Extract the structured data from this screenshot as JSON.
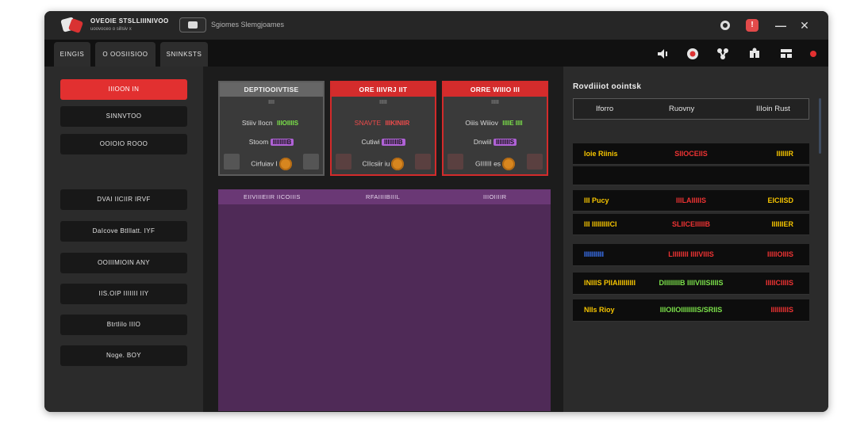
{
  "window": {
    "app_title": "OVEOIE STSLLIIINIVOO",
    "app_subtitle": "uoovoceo o sillsiv x",
    "search_text": "Sgiomes Slemgjoames",
    "controls": {
      "help": "help-icon",
      "alert": "!",
      "minimize": "—",
      "close": "✕"
    }
  },
  "tabs": [
    "EINGIS",
    "O OOSIISIOO",
    "SNINKSTS"
  ],
  "toolbar_icons": [
    "volume-icon",
    "record-icon",
    "share-icon",
    "puzzle-icon",
    "menu-icon",
    "status-dot-icon"
  ],
  "colors": {
    "accent": "#e23030",
    "purple": "#4f2a57",
    "green": "#7be04a",
    "yellow": "#f5c400",
    "blue": "#3e78ff"
  },
  "sidebar": {
    "items": [
      {
        "label": "IIIOON IN",
        "active": true
      },
      {
        "label": "SINNVTOO",
        "active": false
      },
      {
        "label": "OOIOIO ROOO",
        "active": false
      },
      {
        "label": "DVAI IICIIR IRVF",
        "active": false
      },
      {
        "label": "DaIcove Btlllatt. IYF",
        "active": false
      },
      {
        "label": "OOIIIMIOIN ANY",
        "active": false
      },
      {
        "label": "IIS.OIP IIIIIII IIY",
        "active": false
      },
      {
        "label": "Btrtlilo IIIO",
        "active": false
      },
      {
        "label": "Noge. BOY",
        "active": false
      }
    ]
  },
  "cards": [
    {
      "title": "DEPTIOOIVTISE",
      "sub": "IIII",
      "row1_label": "Stiiiv IIocn",
      "row1_value": "IIIOIIIIS",
      "row2_label": "Stoom",
      "row2_value": "IIIIIIIIB",
      "row3_label": "Cirfuiav I"
    },
    {
      "title": "ORE IIIVRJ IIT",
      "sub": "IIIII",
      "row1_label": "SNAVTE",
      "row1_value": "IIIKINIIR",
      "row2_label": "Cutiwi",
      "row2_value": "IIIIIIIIB",
      "row3_label": "CIIcsiir iu"
    },
    {
      "title": "ORRE WIIIO III",
      "sub": "IIIII",
      "row1_label": "Oiiis Wiiiov",
      "row1_value": "IIIIE IIII",
      "row2_label": "Dnwiil",
      "row2_value": "IIIIIIIIS",
      "row3_label": "GIIIIII es"
    }
  ],
  "purple_panel": {
    "headers": [
      "EIIVIIIEIIR IICOIIIS",
      "RFAIIIIBIIIL",
      "IIIOIIIIR"
    ]
  },
  "right_panel": {
    "title": "Rovdiiiot oointsk",
    "headers": [
      "Iforro",
      "Ruovny",
      "IIIoin Rust"
    ],
    "rows": [
      {
        "c1": "Ioie Riinis",
        "c2": "SIIOCEIIS",
        "c3": "IIIIIIR",
        "c1_color": "#f5c400",
        "c2_color": "#ee3333",
        "c3_color": "#f5c400"
      },
      {
        "c1": "",
        "c2": "",
        "c3": "",
        "c1_color": "#f5c400",
        "c2_color": "#ee3333",
        "c3_color": "#f5c400"
      },
      {
        "c1": "III Pucy",
        "c2": "IIILAIIIIIS",
        "c3": "EICIISD",
        "c1_color": "#f5c400",
        "c2_color": "#ee3333",
        "c3_color": "#f5c400"
      },
      {
        "c1": "III IIIIIIIIICI",
        "c2": "SLIICEIIIIIB",
        "c3": "IIIIIIER",
        "c1_color": "#f5c400",
        "c2_color": "#ee3333",
        "c3_color": "#f5c400"
      },
      {
        "c1": "IIIIIIIIII",
        "c2": "LIIIIIIII IIIIVIIIS",
        "c3": "IIIIIOIIIS",
        "c1_color": "#3e78ff",
        "c2_color": "#ee3333",
        "c3_color": "#ee3333"
      },
      {
        "c1": "INIIIS PIIAIIIIIIIII",
        "c2": "DIIIIIIIIB IIIIVIIISIIIIS",
        "c3": "IIIIICIIIIS",
        "c1_color": "#f5c400",
        "c2_color": "#7be04a",
        "c3_color": "#ee3333"
      },
      {
        "c1": "NIIs Rioy",
        "c2": "IIIOIIOIIIIIIIIS/SRIIS",
        "c3": "IIIIIIIIIS",
        "c1_color": "#f5c400",
        "c2_color": "#7be04a",
        "c3_color": "#ee3333"
      }
    ]
  }
}
